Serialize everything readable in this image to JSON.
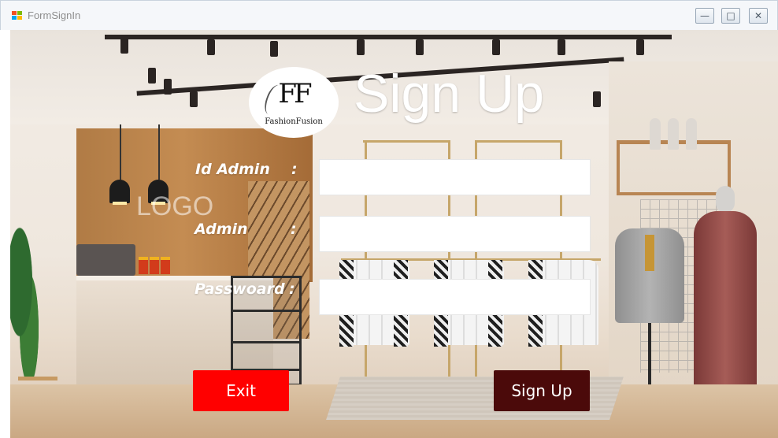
{
  "window": {
    "title": "FormSignIn",
    "controls": {
      "minimize": "—",
      "maximize": "□",
      "close": "✕"
    }
  },
  "logo": {
    "initials": "FF",
    "brand": "FashionFusion"
  },
  "background_sign": "LOGO",
  "header": {
    "title": "Sign Up"
  },
  "form": {
    "fields": [
      {
        "label": "Id Admin",
        "colon": ":",
        "value": ""
      },
      {
        "label": "Admin",
        "colon": ":",
        "value": ""
      },
      {
        "label": "Passwoard",
        "colon": ":",
        "value": ""
      }
    ]
  },
  "buttons": {
    "exit": "Exit",
    "sign_up": "Sign Up"
  },
  "colors": {
    "exit_button": "#ff0000",
    "sign_up_button": "#4b0a0a",
    "title_text": "#ffffff"
  }
}
